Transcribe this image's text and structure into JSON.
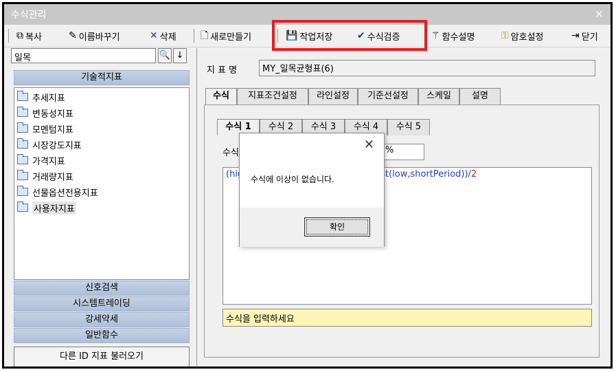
{
  "window": {
    "title": "수식관리",
    "close_glyph": "✕"
  },
  "toolbar": {
    "copy": "복사",
    "rename": "이름바꾸기",
    "delete": "삭제",
    "new": "새로만들기",
    "save": "작업저장",
    "validate": "수식검증",
    "functions": "함수설명",
    "password": "암호설정",
    "close": "닫기"
  },
  "left": {
    "search_value": "일목",
    "search_btn": "🔍",
    "down_btn": "↓",
    "category_top": "기술적지표",
    "tree_items": [
      "추세지표",
      "변동성지표",
      "모멘텀지표",
      "시장강도지표",
      "가격지표",
      "거래량지표",
      "선물옵션전용지표",
      "사용자지표"
    ],
    "categories_bottom": [
      "신호검색",
      "시스템트레이딩",
      "강세약세",
      "일반함수"
    ],
    "load_button": "다른 ID 지표 불러오기"
  },
  "right": {
    "name_label": "지 표 명",
    "name_value": "MY_일목균형표(6)",
    "tabs": [
      "수식",
      "지표조건설정",
      "라인설정",
      "기준선설정",
      "스케일",
      "설명"
    ],
    "subtabs": [
      "수식 1",
      "수식 2",
      "수식 3",
      "수식 4",
      "수식 5"
    ],
    "formula_label": "수식",
    "pct_value": "%",
    "code_start": "(hig",
    "code_tail_kw": "st",
    "code_tail_args": "(low,shortPeriod))/",
    "code_tail_num": "2",
    "hint": "수식을 입력하세요"
  },
  "dialog": {
    "close_glyph": "✕",
    "message": "수식에 이상이 없습니다.",
    "ok_label": "확인"
  },
  "colors": {
    "highlight": "#e41e1e",
    "category_bg": "#b8c7de",
    "hint_bg": "#fbf6b8"
  }
}
